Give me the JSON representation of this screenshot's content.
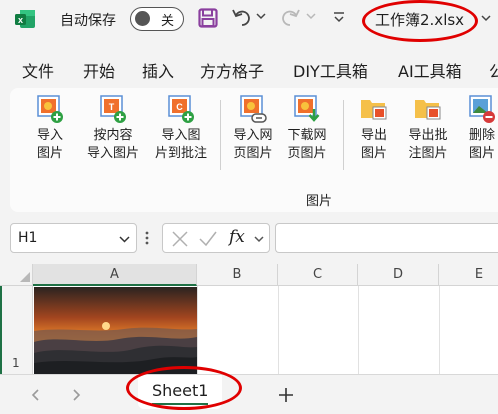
{
  "titlebar": {
    "autosave_label": "自动保存",
    "autosave_state": "关",
    "filename": "工作簿2.xlsx"
  },
  "menu": [
    "文件",
    "开始",
    "插入",
    "方方格子",
    "DIY工具箱",
    "AI工具箱",
    "公"
  ],
  "ribbon": {
    "buttons": [
      {
        "line1": "导入",
        "line2": "图片",
        "icon": "image-add-icon"
      },
      {
        "line1": "按内容",
        "line2": "导入图片",
        "icon": "content-image-add-icon"
      },
      {
        "line1": "导入图",
        "line2": "片到批注",
        "icon": "comment-image-add-icon"
      },
      {
        "line1": "导入网",
        "line2": "页图片",
        "icon": "web-image-link-icon"
      },
      {
        "line1": "下载网",
        "line2": "页图片",
        "icon": "web-image-download-icon"
      },
      {
        "line1": "导出",
        "line2": "图片",
        "icon": "folder-image-export-icon"
      },
      {
        "line1": "导出批",
        "line2": "注图片",
        "icon": "folder-comment-export-icon"
      },
      {
        "line1": "删除",
        "line2": "图片",
        "icon": "image-delete-icon"
      }
    ],
    "group_label": "图片"
  },
  "formula_bar": {
    "name_box": "H1",
    "fx": "fx",
    "formula": ""
  },
  "grid": {
    "columns": [
      "A",
      "B",
      "C",
      "D",
      "E"
    ],
    "rows": [
      "1"
    ]
  },
  "sheets": {
    "tabs": [
      "Sheet1"
    ],
    "add_symbol": "+"
  },
  "colors": {
    "accent_green": "#1e7145",
    "annotation_red": "#e00000",
    "toolbar_purple": "#8a3f9e"
  }
}
